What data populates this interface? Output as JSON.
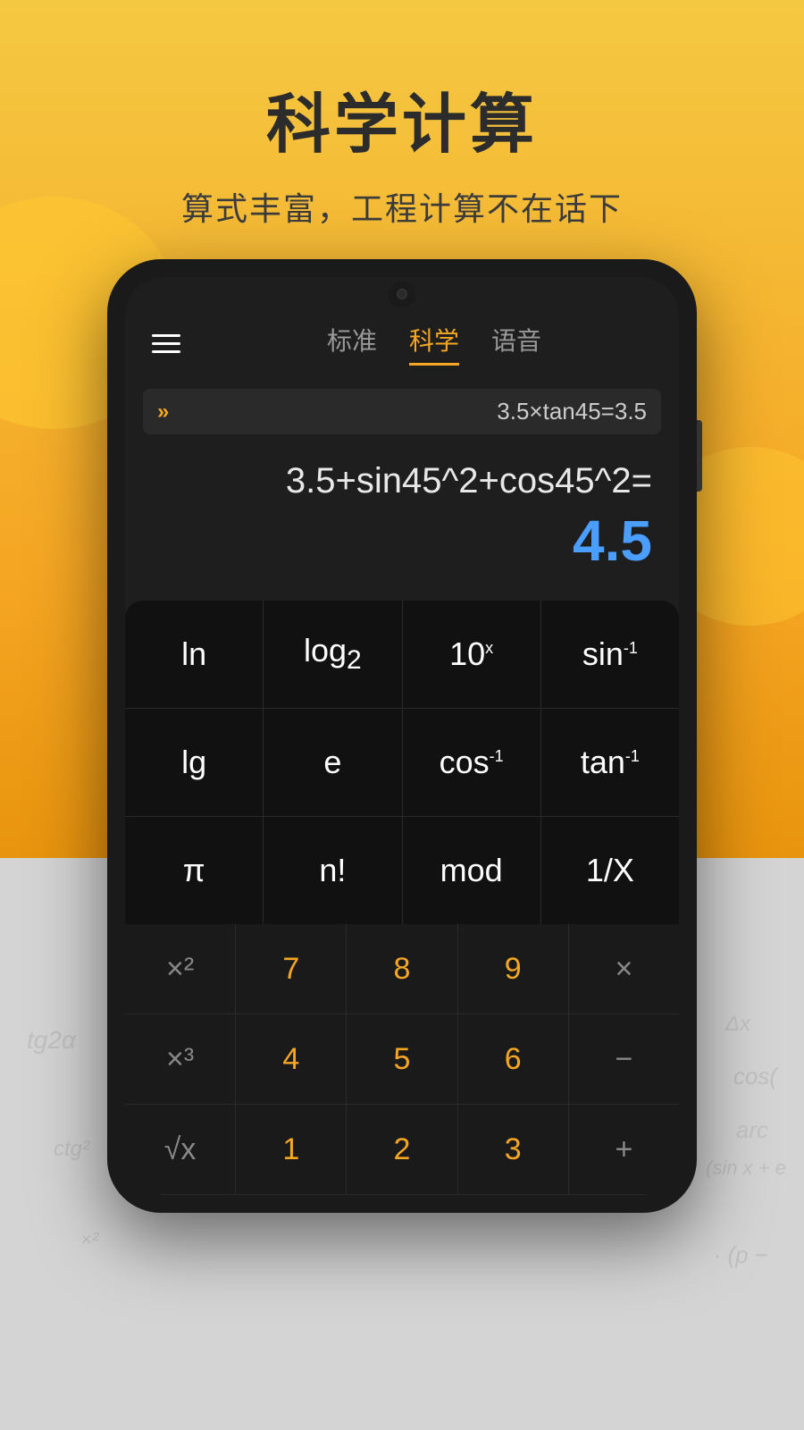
{
  "header": {
    "title": "科学计算",
    "subtitle": "算式丰富，工程计算不在话下"
  },
  "app": {
    "tabs": [
      {
        "label": "标准",
        "active": false
      },
      {
        "label": "科学",
        "active": true
      },
      {
        "label": "语音",
        "active": false
      }
    ],
    "history": "3.5×tan45=3.5",
    "expression": "3.5+sin45^2+cos45^2=",
    "result": "4.5",
    "chevron": "»"
  },
  "sci_keys": [
    [
      {
        "label": "ln"
      },
      {
        "label": "log₂"
      },
      {
        "label": "10ˣ"
      },
      {
        "label": "sin⁻¹"
      }
    ],
    [
      {
        "label": "lg"
      },
      {
        "label": "e"
      },
      {
        "label": "cos⁻¹"
      },
      {
        "label": "tan⁻¹"
      }
    ],
    [
      {
        "label": "π"
      },
      {
        "label": "n!"
      },
      {
        "label": "mod"
      },
      {
        "label": "1/X"
      }
    ]
  ],
  "num_keys": [
    [
      {
        "label": "×²",
        "color": "gray"
      },
      {
        "label": "7",
        "color": "orange"
      },
      {
        "label": "8",
        "color": "orange"
      },
      {
        "label": "9",
        "color": "orange"
      },
      {
        "label": "×",
        "color": "gray"
      }
    ],
    [
      {
        "label": "×³",
        "color": "gray"
      },
      {
        "label": "4",
        "color": "orange"
      },
      {
        "label": "5",
        "color": "orange"
      },
      {
        "label": "6",
        "color": "orange"
      },
      {
        "label": "−",
        "color": "gray"
      }
    ],
    [
      {
        "label": "√x",
        "color": "gray"
      },
      {
        "label": "1",
        "color": "orange"
      },
      {
        "label": "2",
        "color": "orange"
      },
      {
        "label": "3",
        "color": "orange"
      },
      {
        "label": "+",
        "color": "gray"
      }
    ]
  ]
}
